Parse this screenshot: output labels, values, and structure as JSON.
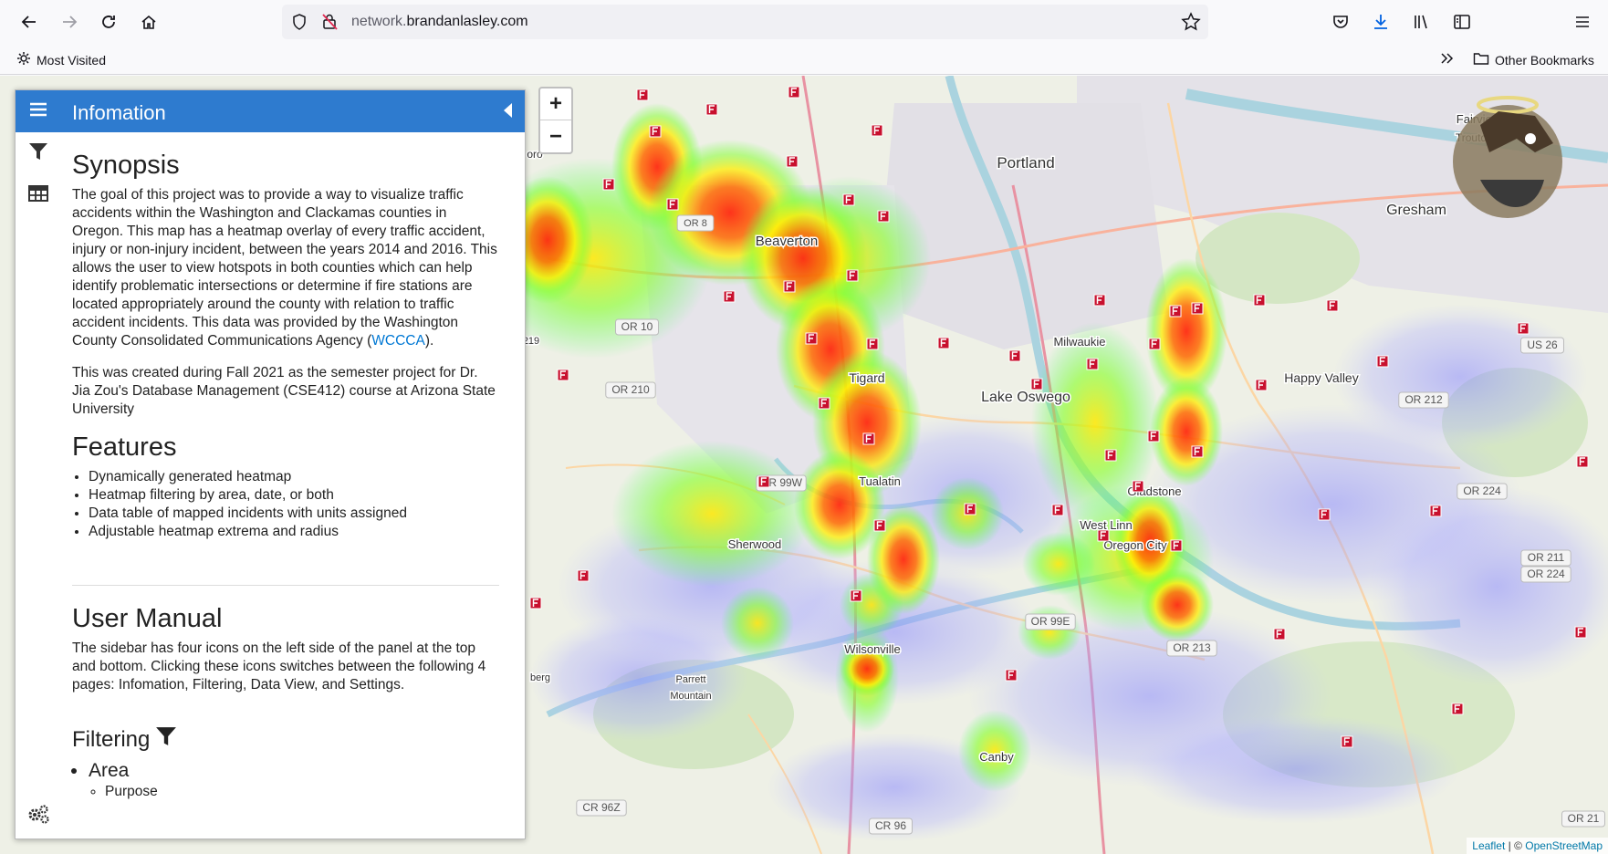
{
  "browser": {
    "url_prefix": "network.",
    "url_domain": "brandanlasley.com",
    "bookmarks": {
      "most_visited": "Most Visited",
      "other": "Other Bookmarks"
    }
  },
  "sidebar": {
    "title": "Infomation",
    "synopsis": {
      "heading": "Synopsis",
      "p1_text": "The goal of this project was to provide a way to visualize traffic accidents within the Washington and Clackamas counties in Oregon. This map has a heatmap overlay of every traffic accident, injury or non-injury incident, between the years 2014 and 2016. This allows the user to view hotspots in both counties which can help identify problematic intersections or determine if fire stations are located appropriately around the county with relation to traffic accident incidents. This data was provided by the Washington County Consolidated Communications Agency (",
      "p1_link": "WCCCA",
      "p1_end": ").",
      "p2": "This was created during Fall 2021 as the semester project for Dr. Jia Zou's Database Management (CSE412) course at Arizona State University"
    },
    "features": {
      "heading": "Features",
      "items": [
        "Dynamically generated heatmap",
        "Heatmap filtering by area, date, or both",
        "Data table of mapped incidents with units assigned",
        "Adjustable heatmap extrema and radius"
      ]
    },
    "manual": {
      "heading": "User Manual",
      "text": "The sidebar has four icons on the left side of the panel at the top and bottom. Clicking these icons switches between the following 4 pages: Infomation, Filtering, Data View, and Settings."
    },
    "filtering": {
      "heading": "Filtering",
      "area": "Area",
      "sub": "Purpose"
    }
  },
  "map": {
    "zoom_in": "+",
    "zoom_out": "−",
    "attribution_leaflet": "Leaflet",
    "attribution_sep": " | © ",
    "attribution_osm": "OpenStreetMap",
    "labels": [
      {
        "text": "Portland",
        "size": 17
      },
      {
        "text": "Gresham",
        "size": 16
      },
      {
        "text": "Beaverton",
        "size": 15
      },
      {
        "text": "Tigard",
        "size": 14
      },
      {
        "text": "Lake Oswego",
        "size": 16
      },
      {
        "text": "Milwaukie",
        "size": 13
      },
      {
        "text": "Happy Valley",
        "size": 14
      },
      {
        "text": "Tualatin",
        "size": 13
      },
      {
        "text": "Sherwood",
        "size": 13
      },
      {
        "text": "West Linn",
        "size": 13
      },
      {
        "text": "Oregon City",
        "size": 13
      },
      {
        "text": "Gladstone",
        "size": 13
      },
      {
        "text": "Wilsonville",
        "size": 13
      },
      {
        "text": "Canby",
        "size": 13
      },
      {
        "text": "Parrett",
        "size": 11
      },
      {
        "text": "Mountain",
        "size": 11
      },
      {
        "text": "Fairview",
        "size": 13
      },
      {
        "text": "Troutdale",
        "size": 12
      },
      {
        "text": "OR 10",
        "size": 12
      },
      {
        "text": "OR 210",
        "size": 12
      },
      {
        "text": "OR 99W",
        "size": 12
      },
      {
        "text": "OR 99E",
        "size": 12
      },
      {
        "text": "OR 213",
        "size": 12
      },
      {
        "text": "OR 212",
        "size": 12
      },
      {
        "text": "OR 224",
        "size": 12
      },
      {
        "text": "OR 211",
        "size": 12
      },
      {
        "text": "OR 224",
        "size": 12
      },
      {
        "text": "US 26",
        "size": 12
      },
      {
        "text": "CR 96Z",
        "size": 12
      },
      {
        "text": "CR 96",
        "size": 12
      },
      {
        "text": "OR 21",
        "size": 12
      },
      {
        "text": "OR 8",
        "size": 11
      },
      {
        "text": "219",
        "size": 11
      },
      {
        "text": "berg",
        "size": 11
      },
      {
        "text": "oro",
        "size": 12
      }
    ]
  },
  "colors": {
    "accent": "#2e7bcf",
    "station": "#c8102e"
  }
}
